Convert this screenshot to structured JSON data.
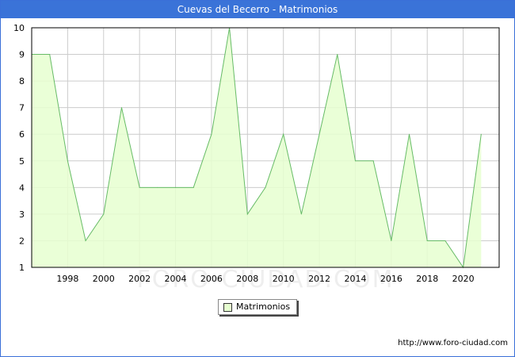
{
  "header": {
    "title": "Cuevas del Becerro - Matrimonios"
  },
  "legend": {
    "label": "Matrimonios"
  },
  "footer": {
    "url": "http://www.foro-ciudad.com"
  },
  "watermark": "FORO-CIUDAD.COM",
  "colors": {
    "title_bar": "#3a73d8",
    "area_fill": "#e6ffd0",
    "line": "#66bb66",
    "grid": "#cccccc"
  },
  "chart_data": {
    "type": "area",
    "title": "Cuevas del Becerro - Matrimonios",
    "xlabel": "",
    "ylabel": "",
    "x": [
      1996,
      1997,
      1998,
      1999,
      2000,
      2001,
      2002,
      2003,
      2004,
      2005,
      2006,
      2007,
      2008,
      2009,
      2010,
      2011,
      2012,
      2013,
      2014,
      2015,
      2016,
      2017,
      2018,
      2019,
      2020,
      2021
    ],
    "series": [
      {
        "name": "Matrimonios",
        "values": [
          9,
          9,
          5,
          2,
          3,
          7,
          4,
          4,
          4,
          4,
          6,
          10,
          3,
          4,
          6,
          3,
          6,
          9,
          5,
          5,
          2,
          6,
          2,
          2,
          1,
          6
        ]
      }
    ],
    "x_ticks": [
      1998,
      2000,
      2002,
      2004,
      2006,
      2008,
      2010,
      2012,
      2014,
      2016,
      2018,
      2020
    ],
    "y_ticks": [
      1,
      2,
      3,
      4,
      5,
      6,
      7,
      8,
      9,
      10
    ],
    "xlim": [
      1996,
      2022
    ],
    "ylim": [
      1,
      10
    ],
    "grid": true,
    "legend_position": "bottom-center"
  }
}
